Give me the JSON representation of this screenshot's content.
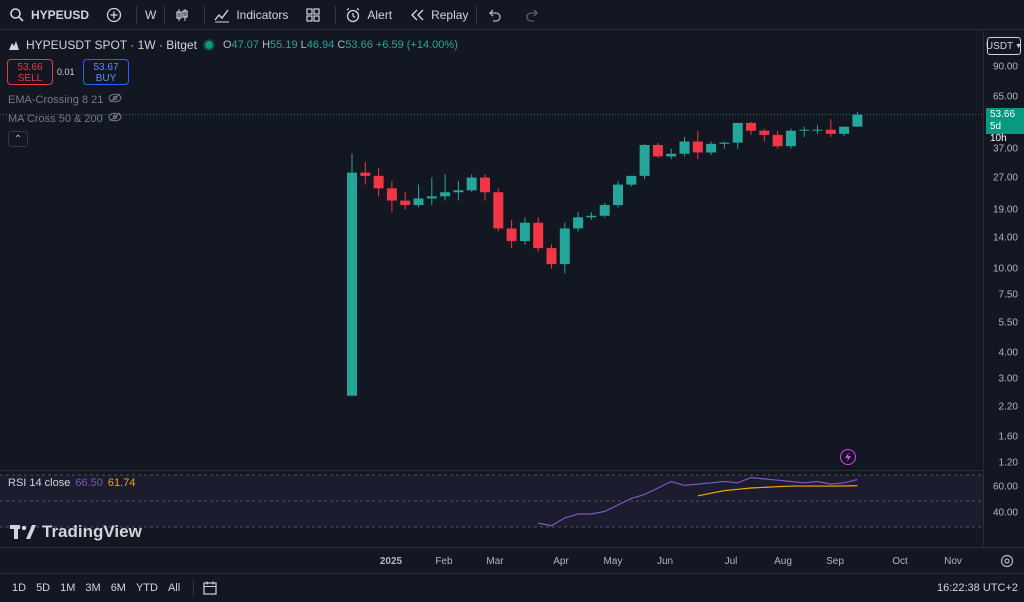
{
  "toolbar": {
    "symbol": "HYPEUSD",
    "interval": "W",
    "indicators_label": "Indicators",
    "alert_label": "Alert",
    "replay_label": "Replay"
  },
  "legend": {
    "title": "HYPEUSDT SPOT · 1W · Bitget",
    "o_label": "O",
    "o": "47.07",
    "h_label": "H",
    "h": "55.19",
    "l_label": "L",
    "l": "46.94",
    "c_label": "C",
    "c": "53.66",
    "change": "+6.59 (+14.00%)"
  },
  "trade": {
    "sell_price": "53.66",
    "sell_label": "SELL",
    "spread": "0.01",
    "buy_price": "53.67",
    "buy_label": "BUY"
  },
  "indicators": [
    {
      "label": "EMA-Crossing 8 21"
    },
    {
      "label": "MA Cross 50 & 200"
    }
  ],
  "price_scale": {
    "currency": "USDT",
    "labels": [
      "90.00",
      "65.00",
      "37.00",
      "27.00",
      "19.00",
      "14.00",
      "10.00",
      "7.50",
      "5.50",
      "4.00",
      "3.00",
      "2.20",
      "1.60",
      "1.20"
    ],
    "last_price": "53.66",
    "countdown": "5d 10h"
  },
  "rsi": {
    "label": "RSI 14 close",
    "value": "66.50",
    "ma_value": "61.74",
    "levels": [
      "60.00",
      "40.00"
    ]
  },
  "brand": {
    "name": "TradingView"
  },
  "time_axis": [
    "2025",
    "Feb",
    "Mar",
    "Apr",
    "May",
    "Jun",
    "Jul",
    "Aug",
    "Sep",
    "Oct",
    "Nov"
  ],
  "bottom": {
    "ranges": [
      "1D",
      "5D",
      "1M",
      "3M",
      "6M",
      "YTD",
      "All"
    ],
    "clock": "16:22:38 UTC+2"
  },
  "colors": {
    "up": "#26a69a",
    "down": "#f23645",
    "rsi": "#7e57c2",
    "rsi_ma": "#f7a600"
  },
  "chart_data": {
    "type": "candlestick",
    "scale": "log",
    "ylim": [
      1.1,
      100
    ],
    "candles": [
      {
        "o": 2.5,
        "h": 35,
        "l": 2.5,
        "c": 28.5
      },
      {
        "o": 28.5,
        "h": 32,
        "l": 25,
        "c": 27.5
      },
      {
        "o": 27.5,
        "h": 30,
        "l": 22,
        "c": 24
      },
      {
        "o": 24,
        "h": 26,
        "l": 18.5,
        "c": 21
      },
      {
        "o": 21,
        "h": 23,
        "l": 19,
        "c": 20
      },
      {
        "o": 20,
        "h": 25,
        "l": 19.5,
        "c": 21.5
      },
      {
        "o": 21.5,
        "h": 27,
        "l": 20,
        "c": 22
      },
      {
        "o": 22,
        "h": 28,
        "l": 21,
        "c": 23
      },
      {
        "o": 23,
        "h": 26,
        "l": 21,
        "c": 23.5
      },
      {
        "o": 23.5,
        "h": 28,
        "l": 23,
        "c": 27
      },
      {
        "o": 27,
        "h": 28,
        "l": 21,
        "c": 23
      },
      {
        "o": 23,
        "h": 24,
        "l": 15,
        "c": 15.5
      },
      {
        "o": 15.5,
        "h": 17,
        "l": 12.5,
        "c": 13.5
      },
      {
        "o": 13.5,
        "h": 17.5,
        "l": 13,
        "c": 16.5
      },
      {
        "o": 16.5,
        "h": 17.5,
        "l": 12,
        "c": 12.5
      },
      {
        "o": 12.5,
        "h": 13,
        "l": 10,
        "c": 10.5
      },
      {
        "o": 10.5,
        "h": 16.5,
        "l": 9.5,
        "c": 15.5
      },
      {
        "o": 15.5,
        "h": 18.5,
        "l": 15,
        "c": 17.5
      },
      {
        "o": 17.5,
        "h": 18.5,
        "l": 17,
        "c": 17.8
      },
      {
        "o": 17.8,
        "h": 20.5,
        "l": 17.5,
        "c": 20
      },
      {
        "o": 20,
        "h": 26,
        "l": 19.5,
        "c": 25
      },
      {
        "o": 25,
        "h": 27.5,
        "l": 24.5,
        "c": 27.5
      },
      {
        "o": 27.5,
        "h": 39,
        "l": 26.5,
        "c": 38.5
      },
      {
        "o": 38.5,
        "h": 39.5,
        "l": 33.5,
        "c": 34
      },
      {
        "o": 34,
        "h": 37,
        "l": 33,
        "c": 35
      },
      {
        "o": 35,
        "h": 42,
        "l": 34,
        "c": 40
      },
      {
        "o": 40,
        "h": 45,
        "l": 33,
        "c": 35.5
      },
      {
        "o": 35.5,
        "h": 40,
        "l": 34.5,
        "c": 39
      },
      {
        "o": 39,
        "h": 40,
        "l": 37,
        "c": 39.5
      },
      {
        "o": 39.5,
        "h": 43,
        "l": 37,
        "c": 49
      },
      {
        "o": 49,
        "h": 49.5,
        "l": 43,
        "c": 45
      },
      {
        "o": 45,
        "h": 46,
        "l": 40,
        "c": 43
      },
      {
        "o": 43,
        "h": 45,
        "l": 37,
        "c": 38
      },
      {
        "o": 38,
        "h": 46,
        "l": 37,
        "c": 45
      },
      {
        "o": 45,
        "h": 47,
        "l": 42,
        "c": 45.5
      },
      {
        "o": 45.5,
        "h": 48,
        "l": 43.5,
        "c": 45.5
      },
      {
        "o": 45.5,
        "h": 51,
        "l": 42,
        "c": 43.5
      },
      {
        "o": 43.5,
        "h": 47,
        "l": 42.5,
        "c": 47
      },
      {
        "o": 47.07,
        "h": 55.19,
        "l": 46.94,
        "c": 53.66
      }
    ],
    "rsi_values": [
      null,
      null,
      null,
      null,
      null,
      null,
      null,
      null,
      null,
      null,
      null,
      null,
      null,
      null,
      33,
      31,
      37,
      40,
      40,
      42,
      47,
      52,
      55,
      60,
      65,
      62,
      63,
      64,
      65,
      64,
      68,
      67,
      66,
      65,
      64,
      65,
      63,
      64,
      66.5
    ],
    "rsi_ma_values": [
      null,
      null,
      null,
      null,
      null,
      null,
      null,
      null,
      null,
      null,
      null,
      null,
      null,
      null,
      null,
      null,
      null,
      null,
      null,
      null,
      null,
      null,
      null,
      null,
      null,
      null,
      54,
      56,
      58,
      59,
      60,
      60.5,
      61,
      61.5,
      61.5,
      61.5,
      61.5,
      61.6,
      61.74
    ]
  }
}
